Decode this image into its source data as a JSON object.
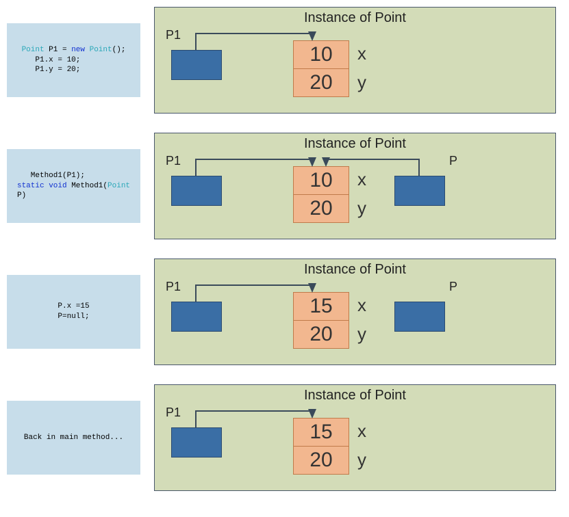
{
  "rows": [
    {
      "code_html": "<span class='kw-type'>Point</span> P1 = <span class='kw-new'>new</span> <span class='kw-type'>Point</span>();\n   P1.x = 10;\n   P1.y = 20;",
      "title": "Instance of Point",
      "p1_label": "P1",
      "val_x": "10",
      "val_y": "20",
      "field_x": "x",
      "field_y": "y",
      "has_p": false,
      "p_arrow": false
    },
    {
      "code_html": "   Method1(P1);\n<span class='kw-mod'>static</span> <span class='kw-mod'>void</span> Method1(<span class='kw-type'>Point</span>\nP)",
      "title": "Instance of Point",
      "p1_label": "P1",
      "p_label": "P",
      "val_x": "10",
      "val_y": "20",
      "field_x": "x",
      "field_y": "y",
      "has_p": true,
      "p_arrow": true
    },
    {
      "code_html": "P.x =15\nP=null;",
      "title": "Instance of Point",
      "p1_label": "P1",
      "p_label": "P",
      "val_x": "15",
      "val_y": "20",
      "field_x": "x",
      "field_y": "y",
      "has_p": true,
      "p_arrow": false
    },
    {
      "code_html": "Back in main method...",
      "title": "Instance of Point",
      "p1_label": "P1",
      "val_x": "15",
      "val_y": "20",
      "field_x": "x",
      "field_y": "y",
      "has_p": false,
      "p_arrow": false
    }
  ]
}
